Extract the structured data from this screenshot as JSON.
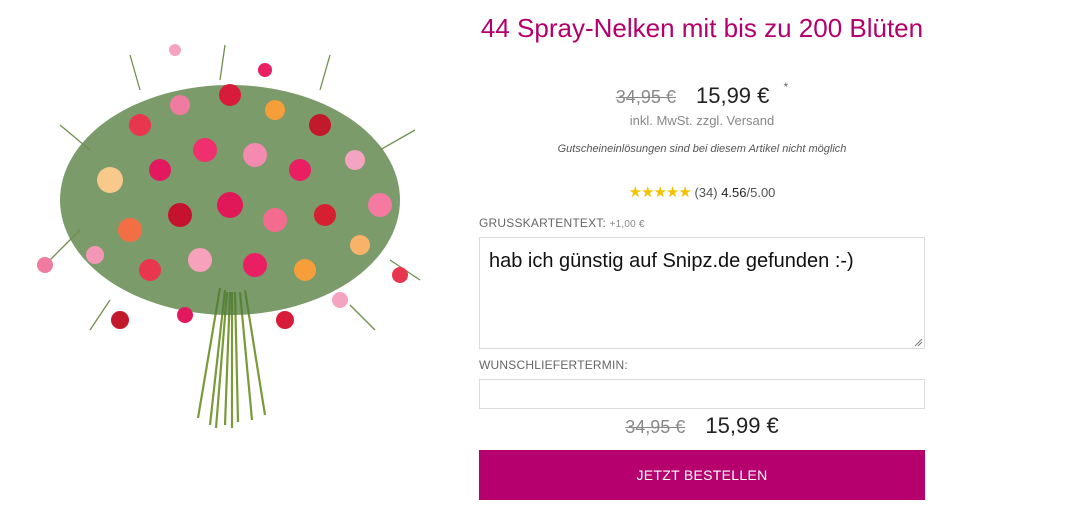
{
  "product": {
    "title": "44 Spray-Nelken mit bis zu 200 Blüten",
    "old_price": "34,95 €",
    "new_price": "15,99 €",
    "asterisk": "*",
    "vat_note": "inkl. MwSt. zzgl. Versand",
    "voucher_note": "Gutscheineinlösungen sind bei diesem Artikel nicht möglich"
  },
  "rating": {
    "stars": "★★★★★",
    "value": 4.56,
    "count": "(34)",
    "score": "4.56",
    "max": "/5.00"
  },
  "form": {
    "greeting_label": "GRUSSKARTENTEXT:",
    "greeting_surcharge": "+1,00 €",
    "greeting_value": "hab ich günstig auf Snipz.de gefunden :-)",
    "delivery_label": "WUNSCHLIEFERTERMIN:",
    "delivery_value": "",
    "order_button": "JETZT BESTELLEN"
  },
  "summary": {
    "old_price": "34,95 €",
    "new_price": "15,99 €"
  },
  "colors": {
    "accent": "#b5006e",
    "title": "#b3006b",
    "stars": "#f2c200"
  }
}
